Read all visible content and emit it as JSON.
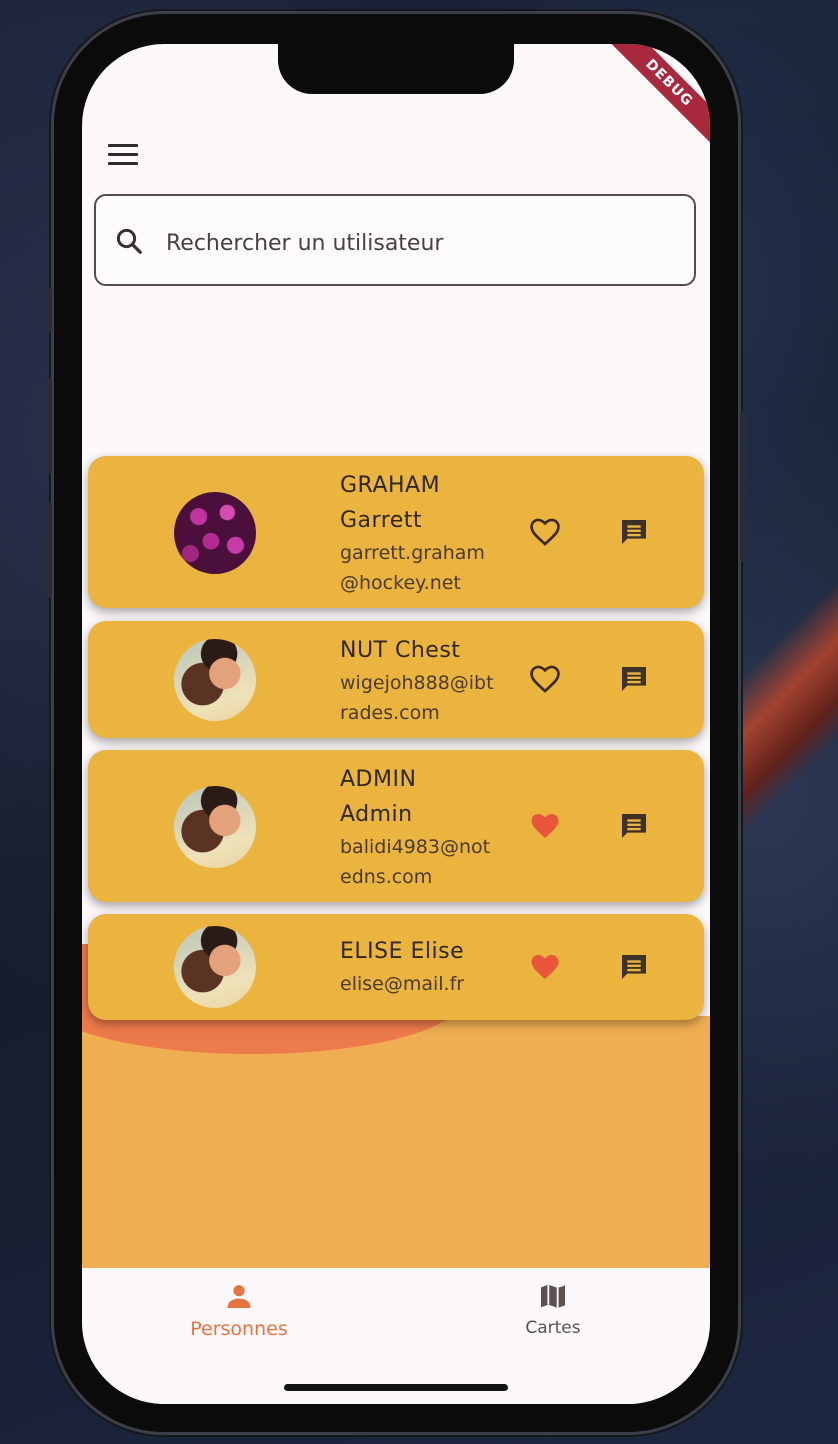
{
  "search": {
    "placeholder": "Rechercher un utilisateur"
  },
  "users": [
    {
      "name_line1": "GRAHAM",
      "name_line2": "Garrett",
      "email": "garrett.graham@hockey.net",
      "favorite": false,
      "avatar": "purple-flowers"
    },
    {
      "name_line1": "NUT Chest",
      "name_line2": "",
      "email": "wigejoh888@ibtrades.com",
      "favorite": false,
      "avatar": "smiling-woman"
    },
    {
      "name_line1": "ADMIN",
      "name_line2": "Admin",
      "email": "balidi4983@notedns.com",
      "favorite": true,
      "avatar": "smiling-woman"
    },
    {
      "name_line1": "ELISE Elise",
      "name_line2": "",
      "email": "elise@mail.fr",
      "favorite": true,
      "avatar": "smiling-woman"
    }
  ],
  "nav": {
    "people_label": "Personnes",
    "maps_label": "Cartes"
  },
  "colors": {
    "card": "#ebb43f",
    "accent": "#ed7a4a",
    "favorite_active": "#e8553a",
    "background_panel": "#f0ae53"
  },
  "icons": {
    "menu": "hamburger-menu-icon",
    "search": "search-icon",
    "favorite": "heart-icon",
    "message": "chat-bubble-icon",
    "people": "person-icon",
    "maps": "map-icon"
  }
}
